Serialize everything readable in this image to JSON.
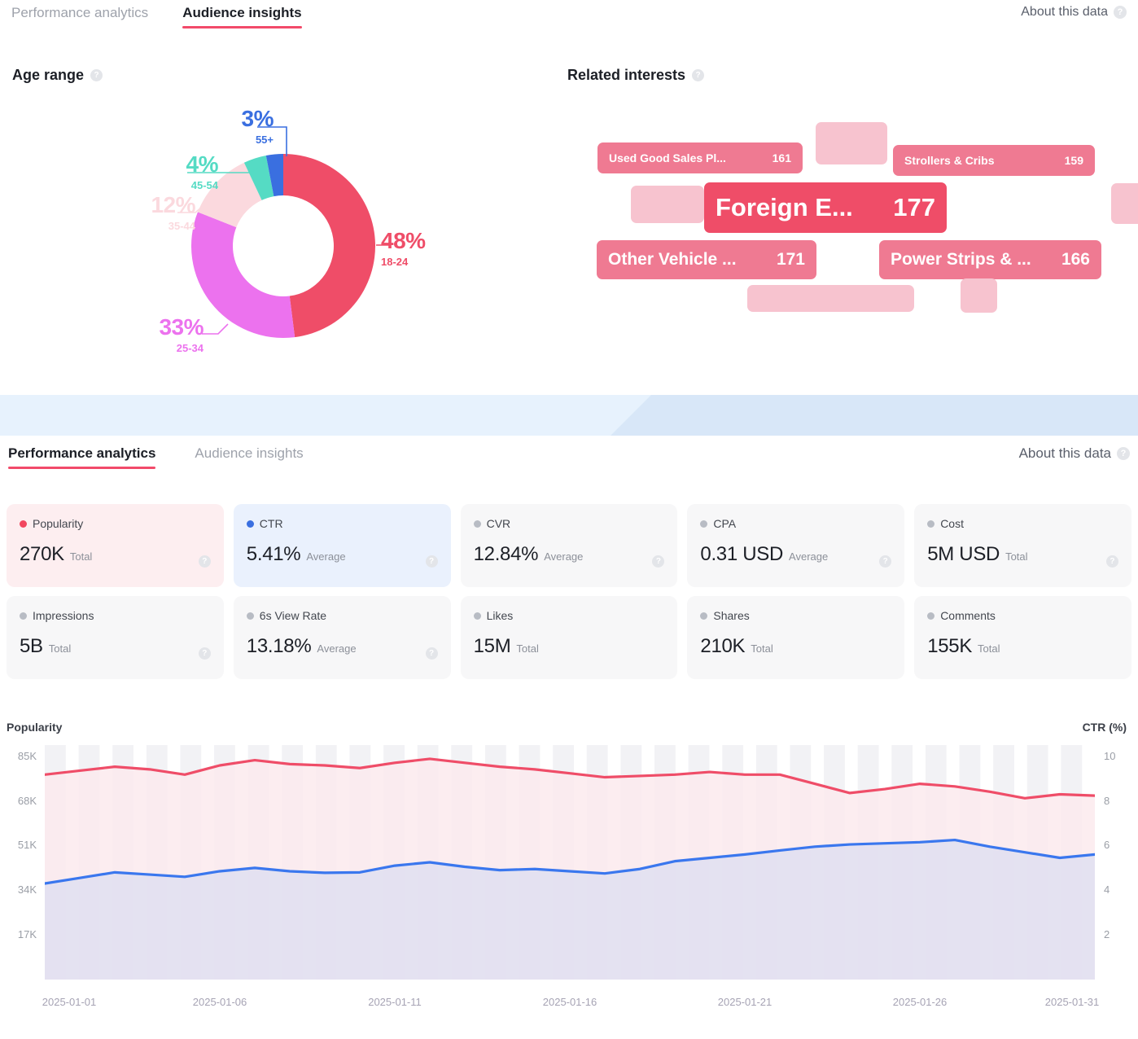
{
  "audience_panel": {
    "tabs": [
      {
        "label": "Performance analytics",
        "active": false
      },
      {
        "label": "Audience insights",
        "active": true
      }
    ],
    "about_label": "About this data",
    "help_glyph": "?",
    "age_range": {
      "title": "Age range",
      "segments": [
        {
          "range": "18-24",
          "percent": "48%",
          "value": 48,
          "color": "#ef4d68"
        },
        {
          "range": "25-34",
          "percent": "33%",
          "value": 33,
          "color": "#ec72ee"
        },
        {
          "range": "35-44",
          "percent": "12%",
          "value": 12,
          "color": "#fbd9de"
        },
        {
          "range": "45-54",
          "percent": "4%",
          "value": 4,
          "color": "#55dbc4"
        },
        {
          "range": "55+",
          "percent": "3%",
          "value": 3,
          "color": "#3a6fe0"
        }
      ]
    },
    "related_interests": {
      "title": "Related interests",
      "chips": [
        {
          "label": "Used Good Sales Pl...",
          "score": "161",
          "color": "#ef7a92",
          "font_size": 14
        },
        {
          "label": "Strollers & Cribs",
          "score": "159",
          "color": "#ef7a92",
          "font_size": 14
        },
        {
          "label": "Foreign E...",
          "score": "177",
          "color": "#ef4d68",
          "font_size": 31
        },
        {
          "label": "Other Vehicle ...",
          "score": "171",
          "color": "#ef7a92",
          "font_size": 21
        },
        {
          "label": "Power Strips & ...",
          "score": "166",
          "color": "#ef7a92",
          "font_size": 21
        }
      ]
    }
  },
  "performance_panel": {
    "tabs": [
      {
        "label": "Performance analytics",
        "active": true
      },
      {
        "label": "Audience insights",
        "active": false
      }
    ],
    "about_label": "About this data",
    "metrics": [
      {
        "name": "Popularity",
        "value": "270K",
        "agg": "Total",
        "dot": "#f2475f",
        "theme": "pop"
      },
      {
        "name": "CTR",
        "value": "5.41%",
        "agg": "Average",
        "dot": "#3a6fe0",
        "theme": "ctr"
      },
      {
        "name": "CVR",
        "value": "12.84%",
        "agg": "Average",
        "dot": "#b8bcc4",
        "theme": ""
      },
      {
        "name": "CPA",
        "value": "0.31 USD",
        "agg": "Average",
        "dot": "#b8bcc4",
        "theme": ""
      },
      {
        "name": "Cost",
        "value": "5M USD",
        "agg": "Total",
        "dot": "#b8bcc4",
        "theme": ""
      },
      {
        "name": "Impressions",
        "value": "5B",
        "agg": "Total",
        "dot": "#b8bcc4",
        "theme": ""
      },
      {
        "name": "6s View Rate",
        "value": "13.18%",
        "agg": "Average",
        "dot": "#b8bcc4",
        "theme": ""
      },
      {
        "name": "Likes",
        "value": "15M",
        "agg": "Total",
        "dot": "#b8bcc4",
        "theme": ""
      },
      {
        "name": "Shares",
        "value": "210K",
        "agg": "Total",
        "dot": "#b8bcc4",
        "theme": ""
      },
      {
        "name": "Comments",
        "value": "155K",
        "agg": "Total",
        "dot": "#b8bcc4",
        "theme": ""
      }
    ],
    "metrics_with_help": [
      true,
      true,
      true,
      true,
      true,
      true,
      true,
      false,
      false,
      false
    ]
  },
  "chart_data": {
    "type": "line",
    "title": "",
    "xlabel": "",
    "ylabel": "Popularity",
    "y2label": "CTR (%)",
    "grid": false,
    "legend": "none",
    "ylim": [
      0,
      89250
    ],
    "y2lim": [
      0,
      10.5
    ],
    "yticks": [
      "85K",
      "68K",
      "51K",
      "34K",
      "17K"
    ],
    "ytick_values": [
      85000,
      68000,
      51000,
      34000,
      17000
    ],
    "y2ticks": [
      "10",
      "8",
      "6",
      "4",
      "2"
    ],
    "y2tick_values": [
      10,
      8,
      6,
      4,
      2
    ],
    "x": [
      "2025-01-01",
      "2025-01-02",
      "2025-01-03",
      "2025-01-04",
      "2025-01-05",
      "2025-01-06",
      "2025-01-07",
      "2025-01-08",
      "2025-01-09",
      "2025-01-10",
      "2025-01-11",
      "2025-01-12",
      "2025-01-13",
      "2025-01-14",
      "2025-01-15",
      "2025-01-16",
      "2025-01-17",
      "2025-01-18",
      "2025-01-19",
      "2025-01-20",
      "2025-01-21",
      "2025-01-22",
      "2025-01-23",
      "2025-01-24",
      "2025-01-25",
      "2025-01-26",
      "2025-01-27",
      "2025-01-28",
      "2025-01-29",
      "2025-01-30",
      "2025-01-31"
    ],
    "xtick_labels": [
      "2025-01-01",
      "2025-01-06",
      "2025-01-11",
      "2025-01-16",
      "2025-01-21",
      "2025-01-26",
      "2025-01-31"
    ],
    "xtick_indices": [
      0,
      5,
      10,
      15,
      20,
      25,
      30
    ],
    "series": [
      {
        "name": "Popularity",
        "axis": "left",
        "color": "#ef4d68",
        "fill": "#fbeaed",
        "values": [
          78000,
          79500,
          81000,
          80000,
          78000,
          81500,
          83500,
          82000,
          81500,
          80500,
          82500,
          84000,
          82500,
          81000,
          80000,
          78500,
          77000,
          77500,
          78000,
          79000,
          78000,
          78000,
          74500,
          71000,
          72500,
          74500,
          73500,
          71500,
          69000,
          70500,
          70000
        ]
      },
      {
        "name": "CTR",
        "axis": "right",
        "color": "#3a77ee",
        "fill": "#dfdff1",
        "values": [
          4.3,
          4.55,
          4.8,
          4.7,
          4.6,
          4.85,
          5.0,
          4.85,
          4.78,
          4.8,
          5.1,
          5.25,
          5.05,
          4.9,
          4.95,
          4.85,
          4.75,
          4.95,
          5.3,
          5.45,
          5.6,
          5.78,
          5.95,
          6.05,
          6.1,
          6.15,
          6.25,
          5.95,
          5.7,
          5.45,
          5.6
        ]
      }
    ]
  }
}
